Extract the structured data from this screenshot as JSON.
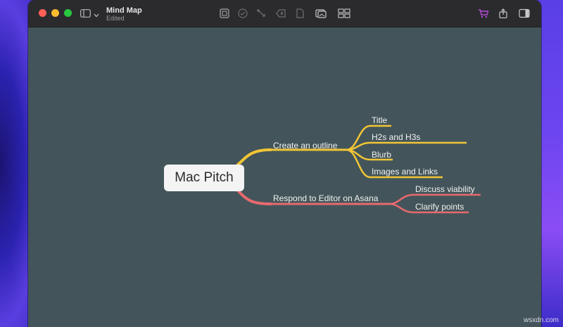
{
  "window": {
    "title": "Mind Map",
    "subtitle": "Edited"
  },
  "toolbar": {
    "icons": [
      "sidebar-icon",
      "chevron-down-icon",
      "add-topic-icon",
      "check-icon",
      "connect-icon",
      "tag-icon",
      "note-icon",
      "image-icon",
      "layout-icon",
      "cart-icon",
      "share-icon",
      "inspector-icon"
    ]
  },
  "mindmap": {
    "root": "Mac Pitch",
    "branches": [
      {
        "label": "Create an outline",
        "color": "#f2c535",
        "children": [
          "Title",
          "H2s and H3s",
          "Blurb",
          "Images and Links"
        ]
      },
      {
        "label": "Respond to Editor on Asana",
        "color": "#e86a6f",
        "children": [
          "Discuss viability",
          "Clarify points"
        ]
      }
    ]
  },
  "watermark": "wsxdn.com",
  "colors": {
    "canvas": "#43555a",
    "titlebar": "#2b2b2e",
    "accent_purple": "#b84bd9"
  }
}
